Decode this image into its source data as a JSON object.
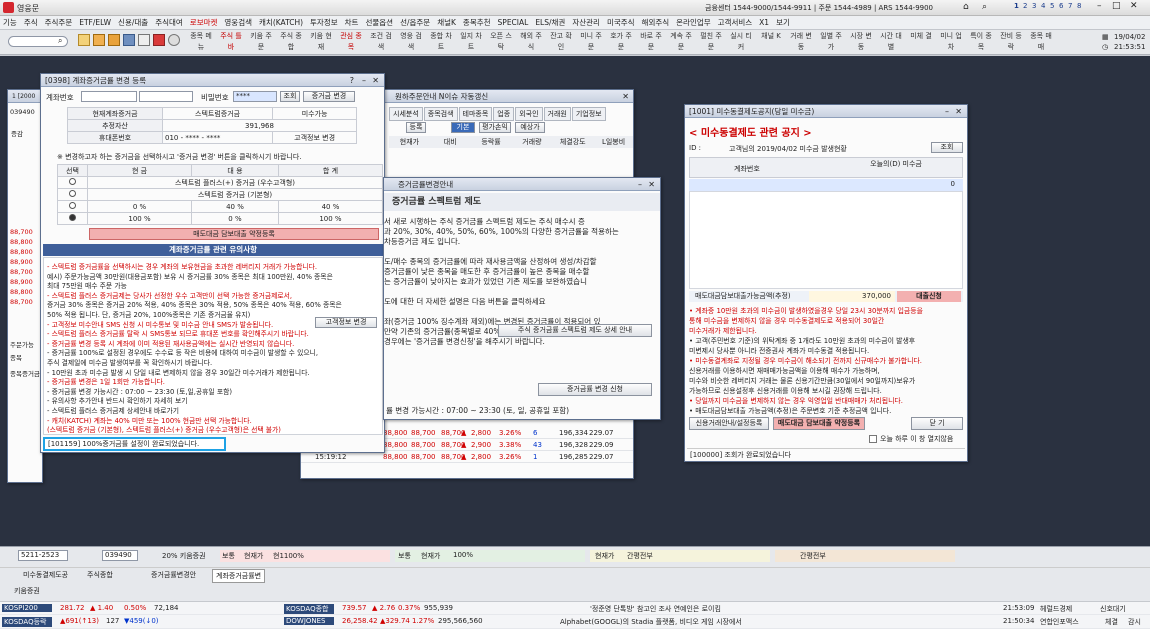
{
  "app": {
    "title": "영웅문",
    "info": "금융센터 1544-9000/1544-9911 | 주문 1544-4989 | ARS 1544-9900",
    "date": "19/04/02",
    "time": "21:53:51",
    "pages": [
      "1",
      "2",
      "3",
      "4",
      "5",
      "6",
      "7",
      "8"
    ]
  },
  "menu": [
    "기능",
    "주식",
    "주식주문",
    "ETF/ELW",
    "신용/대출",
    "주식대여",
    "로보마켓",
    "영웅검색",
    "캐치(KATCH)",
    "투자정보",
    "차트",
    "선물옵션",
    "선/옵주문",
    "채널K",
    "종목추천",
    "SPECIAL",
    "ELS/채권",
    "자산관리",
    "미국주식",
    "해외주식",
    "온라인업무",
    "고객서비스",
    "X1",
    "보기"
  ],
  "toolbar": [
    "종목 메뉴",
    "주식 틀바",
    "키움 주문",
    "주식 종합",
    "키움 현재",
    "관심 종목",
    "조건 검색",
    "영웅 검색",
    "종합 차트",
    "일지 차트",
    "오픈 스탁",
    "해외 주식",
    "잔고 확인",
    "미니 주문",
    "호가 주문",
    "바로 주문",
    "계속 주문",
    "펄친 주문",
    "실시 티커",
    "채널 K",
    "거래 변동",
    "일별 주가",
    "시장 변동",
    "시간 대별",
    "미체 결",
    "미니 업차",
    "특이 종목",
    "잔비 등락",
    "종목 매매"
  ],
  "search_value": "",
  "w0398": {
    "title": "[0398] 계좌증거금률 변경 등록",
    "acct_label": "계좌번호",
    "pw_label": "비밀번호",
    "pw_value": "****",
    "btn_query": "조회",
    "btn_change": "증거금 변경",
    "cur_label": "현재계좌증거금",
    "cur_value": "스텍트럼증거금",
    "cur_value2": "미수가능",
    "asset_label": "추정자산",
    "asset_value": "391,968",
    "phone_label": "휴대폰번호",
    "phone_value": "010 - **** - ****",
    "btn_info": "고객정보 변경",
    "notice": "※ 변경하고자 하는 증거금을 선택하시고 '증거금 변경' 버튼을 클릭하시기 바랍니다.",
    "cols": [
      "선택",
      "현 금",
      "대 용",
      "합 계"
    ],
    "rows": [
      [
        "스텍트럼 플러스(+) 증거금 (우수고객형)",
        "",
        ""
      ],
      [
        "스텍트럼 증거금 (기본형)",
        "",
        ""
      ],
      [
        "0 %",
        "40 %",
        "40 %"
      ],
      [
        "100 %",
        "0 %",
        "100 %"
      ]
    ],
    "agree": "매도대금 담보대출 약정등록",
    "caution_title": "계좌증거금률 관련 유의사항",
    "cautions": [
      "- 스텍트럼 증거금률을 선택하시는 경우 계좌의 보유현금을 초과한 레버리지 거래가 가능합니다.",
      "  예시) 주문가능금액 30만원(대용금포함) 보유 시 증거금률 30% 종목은 최대 100만원, 40% 종목은",
      "  최대 75만원 매수 주문 가능",
      "- 스텍트럼 플러스 증거금제는 당사가 선정한 우수 고객만이 선택 가능한 증거금제로서,",
      "  증거금 30% 종목은 증거금 20% 적용, 40% 종목은 30% 적용, 50% 종목은 40% 적용, 60% 종목은",
      "  50% 적용 됩니다. 단, 증거금 20%, 100%종목은 기존 증거금율 유지)",
      "- 고객정보 미수안내 SMS 신청 시 미수통보 및 미수금 안내 SMS가 발송됩니다.",
      "- 스텍트럼 플러스 증거금률 탈락 시 SMS통보 되므로 휴대폰 번호를 확인해주시기 바랍니다.",
      "- 증거금률 변경 등록 시 계좌에 이미 적용된 재사용금액에는 실시간 반영되지 않습니다.",
      "- 증거금률 100%로 설정된 경우에도 수수료 등 작은 비용에 대하여 미수금이 발생할 수 있으니,",
      "  주식 결제일에 미수금 발생여부를 꼭 확인하시기 바랍니다.",
      "- 10만원 초과 미수금 발생 시 당일 내로 변제하지 않을 경우 30일간 미수거래가 제한됩니다.",
      "- 증거금률 변경은 1일 1회만 가능합니다.",
      "- 증거금률 변경 가능시간 : 07:00 ~ 23:30 (토,일,공휴일 포함)",
      "- 유의사항 추가안내 반드시 확인하기 자세히 보기",
      "- 스텍트럼 플러스 증거금제 상세안내 바로가기",
      "- 캐치(KATCH) 계좌는 40% 미만 또는 100% 현금만 선택 가능합니다.",
      "  (스텍트럼 증거금 (기본형), 스텍트럼 플러스(+) 증거금 (우수고객형)은 선택 불가)"
    ],
    "btn_cust": "고객정보 변경",
    "status": "[101159] 100%증거금률 설정이 완료되었습니다."
  },
  "w_mid": {
    "title": "증거금률변경안내",
    "heading": "증거금률 스펙트럼 제도",
    "lines": [
      "서 새로 시행하는 주식 증거금률 스펙트럼 제도는 주식 매수시 증",
      "과 20%, 30%, 40%, 50%, 60%, 100%의 다양한 증거금률을 적용하는",
      "차등증거금 제도 입니다.",
      "",
      "도/매수 종목의 증거금률에 따라 재사용금액을 산정하여 생성/차감할",
      "증거금률이 낮은 종목을 매도한 후 증거금률이 높은 종목을 매수할",
      "는 증거금률이 낮아지는 효과가 있었던 기존 제도를 보완하였습니",
      "",
      "도에 대한 더 자세한 설명은 다음 버튼을 클릭하세요",
      "",
      "좌(증거금 100% 징수계좌 제외)에는 변경된 증거금률이 적용되어 있",
      "만약 기존의 증거금률(종목별로 40% 또는 100%)을 계속 적용하기를",
      "경우에는 '증거금률 변경신청'을 해주시기 바랍니다."
    ],
    "btn_detail": "주식 증거금률 스펙트럼 제도 상세 안내",
    "btn_apply": "증거금률 변경 신청",
    "footer": "률 변경 가능시간 : 07:00 ~ 23:30 (토, 일, 공휴일 포함)"
  },
  "w_stock": {
    "tabs": [
      "시세분석",
      "종목검색",
      "테마종목",
      "업종",
      "외국인",
      "거래원",
      "기업정보"
    ],
    "btn_order": "등록",
    "btn_base": "기본",
    "btn_eval": "평가손익",
    "btn_order2": "예상가",
    "headers": [
      "현재가",
      "대비",
      "등락률",
      "거래량",
      "체결강도",
      "L일봉비"
    ],
    "title": "원하주문안내 N이슈 자동갱신",
    "ticks": [
      [
        "15:19:12",
        "88,800",
        "88,700",
        "88,700",
        "▲",
        "2,800",
        "3.26%",
        "6",
        "196,334",
        "229.07"
      ],
      [
        "15:19:12",
        "88,800",
        "88,700",
        "88,700",
        "▲",
        "2,900",
        "3.38%",
        "43",
        "196,328",
        "229.09"
      ],
      [
        "15:19:12",
        "88,800",
        "88,700",
        "88,700",
        "▲",
        "2,800",
        "3.26%",
        "1",
        "196,285",
        "229.07"
      ]
    ],
    "left_prices": [
      "88,700",
      "88,800",
      "88,800",
      "88,900",
      "88,700",
      "88,900",
      "88,800",
      "88,700"
    ]
  },
  "w1001": {
    "title": "[1001] 미수동결제도공지(당일 미수금)",
    "headline": "< 미수동결제도 관련 공지 >",
    "id_label": "ID :",
    "id_text": "고객님의 2019/04/02 미수금 발생현황",
    "btn_query": "조회",
    "col1": "계좌번호",
    "col2": "오늘의(D) 미수금",
    "value": "0",
    "loan_label": "매도대금담보대출가능금액(추정)",
    "loan_value": "370,000",
    "loan_btn": "대출신청",
    "notes": [
      "• 계좌중 10만원 초과의 미수금이 발생하였을경우 당일 23시 30분까지 입금등을",
      "  통해 미수금을 변제하지 않을 경우 미수동결제도로 적용되어 30일간",
      "  미수거래가 제한됩니다.",
      "• 고객(주민번호 기준)의 위탁계좌 중 1개라도 10만원 초과의 미수금이 발생후",
      "  미변제시 당사뿐 아니라 전증권사 계좌가 미수동결 적용됩니다.",
      "• 미수동결계좌로 지정될 경우 미수금이 해소되기 전까지 신규매수가 불가합니다.",
      "  신용거래를 이용하시면 재매매가능금액을 이용해 매수가 가능하며,",
      "  미수와 비슷한 레버리지 거래는 물론 신용기간만큼(30일에서 90일까지)보유가",
      "  가능하므로 신용설정후 신용거래를 이용해 보시길 권장해 드립니다.",
      "• 당일까지 미수금을 변제하지 않는 경우 익영업일 반대매매가 처리됩니다.",
      "• 매도대금담보대출 가능금액(추정)은 주문변호 기준 추정금액 입니다."
    ],
    "btn_guide": "신용거래안내/설정등록",
    "btn_sell": "매도대금 담보대출 약정등록",
    "btn_close": "닫 기",
    "chk": "오늘 하루 이 창 열지않음",
    "status": "[100000] 조회가 완료되었습니다"
  },
  "taskbar": {
    "code": "5211-2523",
    "stock": "039490",
    "rate": "20% 키움증권",
    "tags": [
      "보통",
      "현재가",
      "현1100%"
    ],
    "tags2": [
      "보통",
      "현재가",
      "100%"
    ],
    "tags3": [
      "현재가",
      "간평전부"
    ],
    "tags4": [
      "간평전부"
    ],
    "tabs": [
      "미수동결제도공",
      "주식종합",
      "증거금률변경안",
      "계좌증거금률변"
    ],
    "quick": "키움증권",
    "index1": [
      "KOSPI200",
      "281.72",
      "▲ 1.40",
      "0.50%",
      "72,184"
    ],
    "index2": [
      "KOSDAQ종합",
      "739.57",
      "▲ 2.76",
      "0.37%",
      "955,939"
    ],
    "index3": [
      "KOSDAQ등락",
      "▲691(↑13)",
      "127",
      "▼459(↓0)"
    ],
    "index4": [
      "DOWJONES",
      "26,258.42",
      "▲329.74",
      "1.27%",
      "295,566,560"
    ],
    "news1": "'정준영 단톡방' 참고인 조사 연예인은 로이킴",
    "news2": "Alphabet(GOOGL)의 Stadia 플랫폼, 비디오 게임 시장에서",
    "t1": "21:53:09",
    "src1": "헤럴드경제",
    "t2": "21:50:34",
    "src2": "연합인포맥스",
    "ext1": "신호대기",
    "ext2": "체결",
    "ext3": "감시"
  },
  "colors": {
    "accent": "#1a3c8c",
    "red": "#d00000",
    "blue": "#0033cc",
    "highlight": "#1ea2e5"
  }
}
